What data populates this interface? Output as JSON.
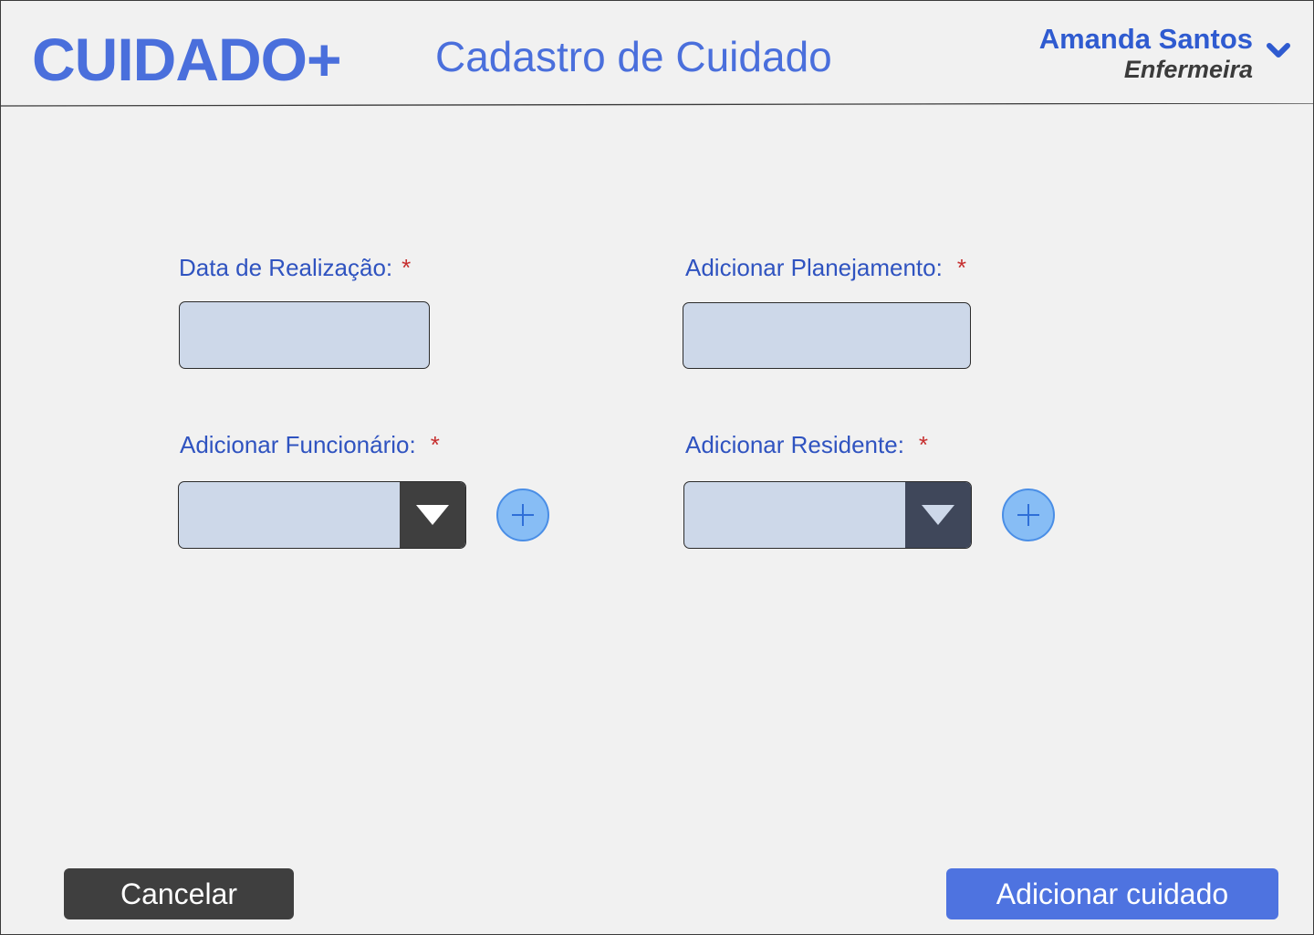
{
  "header": {
    "logo": "CUIDADO+",
    "title": "Cadastro de Cuidado",
    "user": {
      "name": "Amanda Santos",
      "role": "Enfermeira",
      "menu_icon": "chevron-down-icon"
    }
  },
  "form": {
    "date": {
      "label": "Data de Realização:",
      "required": "*",
      "value": ""
    },
    "planning": {
      "label": "Adicionar Planejamento:",
      "required": "*",
      "value": ""
    },
    "employee": {
      "label": "Adicionar Funcionário:",
      "required": "*",
      "value": "",
      "add_icon": "plus-icon",
      "dropdown_icon": "triangle-down-icon"
    },
    "resident": {
      "label": "Adicionar Residente:",
      "required": "*",
      "value": "",
      "add_icon": "plus-icon",
      "dropdown_icon": "triangle-down-icon"
    }
  },
  "actions": {
    "cancel": "Cancelar",
    "submit": "Adicionar cuidado"
  },
  "colors": {
    "accent": "#4a6fdc",
    "label": "#2f53c0",
    "required": "#c62e2e",
    "field_bg": "#cdd8e9",
    "dropdown_employee": "#3f3f3f",
    "dropdown_resident": "#3f475a",
    "add_button": "#87bdf5",
    "cancel_button": "#3f3f3f",
    "submit_button": "#4e73e0",
    "background": "#f1f1f1"
  }
}
